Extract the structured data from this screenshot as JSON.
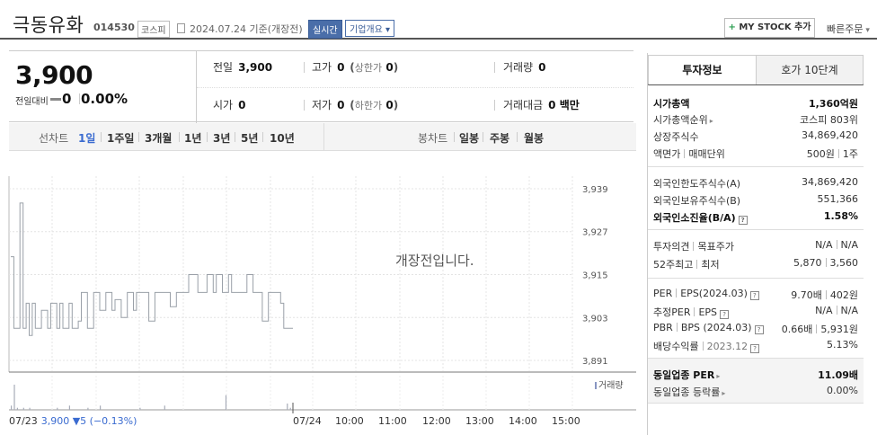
{
  "header": {
    "company_name": "극동유화",
    "stock_code": "014530",
    "market": "코스피",
    "date_basis": "2024.07.24 기준(개장전)",
    "realtime_label": "실시간",
    "overview_label": "기업개요",
    "mystock_label": "MY STOCK 추가",
    "quick_order_label": "빠른주문"
  },
  "summary": {
    "current_price": "3,900",
    "change_label": "전일대비",
    "change_value": "0",
    "change_pct": "0.00%",
    "prev_close_label": "전일",
    "prev_close": "3,900",
    "open_label": "시가",
    "open": "0",
    "high_label": "고가",
    "high": "0",
    "upper_limit_label": "상한가",
    "upper_limit": "0",
    "low_label": "저가",
    "low": "0",
    "lower_limit_label": "하한가",
    "lower_limit": "0",
    "volume_label": "거래량",
    "volume": "0",
    "trade_value_label": "거래대금",
    "trade_value": "0 백만"
  },
  "period_bar": {
    "line_label": "선차트",
    "line_options": [
      "1일",
      "1주일",
      "3개월",
      "1년",
      "3년",
      "5년",
      "10년"
    ],
    "active": "1일",
    "candle_label": "봉차트",
    "candle_options": [
      "일봉",
      "주봉",
      "월봉"
    ]
  },
  "chart_data": {
    "type": "line",
    "notice": "개장전입니다.",
    "y_ticks": [
      "3,939",
      "3,927",
      "3,915",
      "3,903",
      "3,891"
    ],
    "ylim": [
      3888,
      3942
    ],
    "x_ticks": [
      "07/24",
      "10:00",
      "11:00",
      "12:00",
      "13:00",
      "14:00",
      "15:00"
    ],
    "volume_label": "거래량",
    "prev_day": "07/23",
    "prev_price": "3,900",
    "prev_change": "▼5 (−0.13%)",
    "series": [
      {
        "values": [
          3920,
          3900,
          3900,
          3935,
          3900,
          3907,
          3898,
          3907,
          3900,
          3900,
          3905,
          3905,
          3900,
          3907,
          3907,
          3900,
          3907,
          3900,
          3900,
          3907,
          3900,
          3900,
          3902,
          3910,
          3910,
          3900,
          3900,
          3910,
          3910,
          3905,
          3905,
          3910,
          3910,
          3905,
          3908,
          3908,
          3903,
          3903,
          3910,
          3910,
          3905,
          3910,
          3910,
          3910,
          3910,
          3902,
          3902,
          3910,
          3910,
          3910,
          3910,
          3910,
          3906,
          3906,
          3910,
          3910,
          3910,
          3910,
          3915,
          3915,
          3915,
          3910,
          3910,
          3910,
          3915,
          3915,
          3910,
          3915,
          3915,
          3910,
          3910,
          3915,
          3910,
          3910,
          3910,
          3910,
          3910,
          3915,
          3915,
          3910,
          3910,
          3910,
          3902,
          3902,
          3910,
          3910,
          3910,
          3910,
          3907,
          3900,
          3900,
          3900,
          3900
        ]
      }
    ],
    "volume": [
      2,
      12,
      1,
      0,
      1,
      0,
      1,
      0,
      0,
      0,
      0,
      0,
      0,
      0,
      0,
      1,
      0,
      0,
      0,
      2,
      0,
      0,
      0,
      0,
      0,
      1,
      0,
      0,
      0,
      2,
      0,
      0,
      0,
      0,
      0,
      0,
      0,
      0,
      0,
      0,
      0,
      0,
      1,
      0,
      0,
      0,
      0,
      0,
      0,
      0,
      2,
      0,
      0,
      0,
      0,
      0,
      0,
      0,
      0,
      0,
      0,
      0,
      0,
      0,
      0,
      0,
      0,
      0,
      0,
      0,
      7,
      0,
      0,
      0,
      0,
      0,
      0,
      0,
      0,
      0,
      0,
      0,
      0,
      0,
      0,
      0,
      0,
      0,
      0,
      0,
      3,
      1,
      0
    ]
  },
  "right_panel": {
    "tabs": [
      "투자정보",
      "호가 10단계"
    ],
    "market_cap_label": "시가총액",
    "market_cap": "1,360억원",
    "market_cap_rank_label": "시가총액순위",
    "market_cap_rank": "코스피 803위",
    "shares_label": "상장주식수",
    "shares": "34,869,420",
    "par_label": "액면가",
    "unit_label": "매매단위",
    "par": "500원",
    "unit": "1주",
    "foreign_limit_label": "외국인한도주식수(A)",
    "foreign_limit": "34,869,420",
    "foreign_hold_label": "외국인보유주식수(B)",
    "foreign_hold": "551,366",
    "foreign_ratio_label": "외국인소진율(B/A)",
    "foreign_ratio": "1.58%",
    "opinion_label": "투자의견",
    "target_label": "목표주가",
    "opinion": "N/A",
    "target": "N/A",
    "high52_label": "52주최고",
    "low52_label": "최저",
    "high52": "5,870",
    "low52": "3,560",
    "per_label": "PER",
    "eps_label": "EPS(2024.03)",
    "per": "9.70배",
    "eps": "402원",
    "est_per_label": "추정PER",
    "est_eps_label": "EPS",
    "est_per": "N/A",
    "est_eps": "N/A",
    "pbr_label": "PBR",
    "bps_label": "BPS (2024.03)",
    "pbr": "0.66배",
    "bps": "5,931원",
    "div_label": "배당수익률",
    "div_date": "2023.12",
    "div": "5.13%",
    "ind_per_label": "동일업종 PER",
    "ind_per": "11.09배",
    "ind_rate_label": "동일업종 등락률",
    "ind_rate": "0.00%"
  }
}
